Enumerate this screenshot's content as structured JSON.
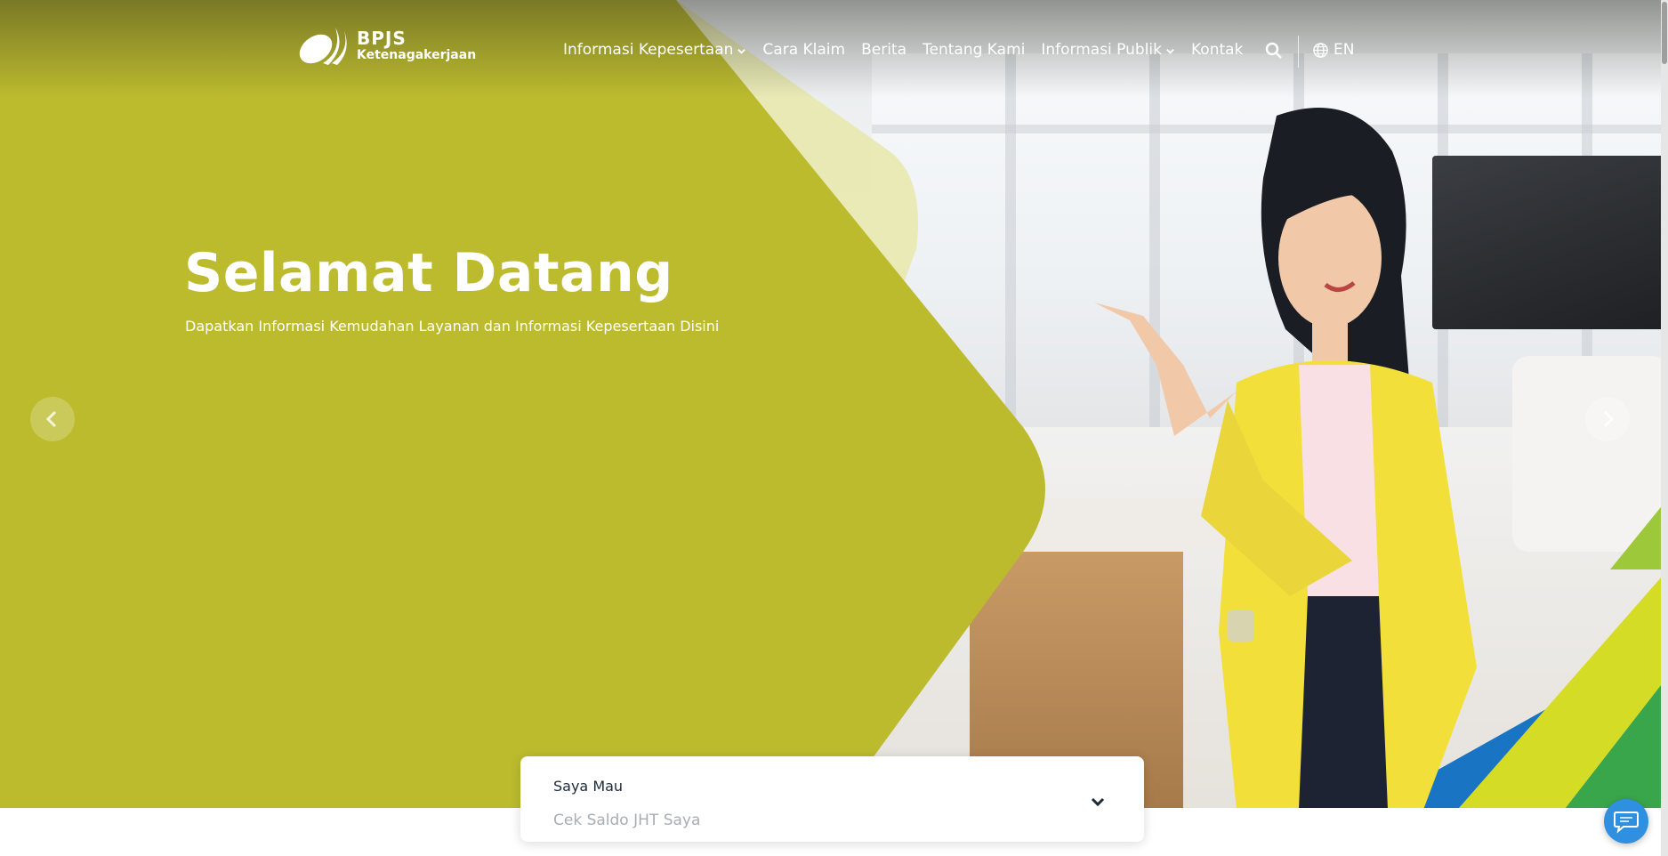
{
  "logo": {
    "title": "BPJS",
    "subtitle": "Ketenagakerjaan"
  },
  "nav": {
    "items": [
      {
        "label": "Informasi Kepesertaan",
        "has_dropdown": true
      },
      {
        "label": "Cara Klaim",
        "has_dropdown": false
      },
      {
        "label": "Berita",
        "has_dropdown": false
      },
      {
        "label": "Tentang Kami",
        "has_dropdown": false
      },
      {
        "label": "Informasi Publik",
        "has_dropdown": true
      },
      {
        "label": "Kontak",
        "has_dropdown": false
      }
    ],
    "search_icon": "search-icon",
    "language": {
      "icon": "globe-icon",
      "label": "EN"
    }
  },
  "hero": {
    "title": "Selamat Datang",
    "subtitle": "Dapatkan Informasi Kemudahan Layanan dan Informasi Kepesertaan Disini",
    "prev_icon": "chevron-left-icon",
    "next_icon": "chevron-right-icon"
  },
  "selector": {
    "label": "Saya Mau",
    "value": "Cek Saldo JHT Saya",
    "icon": "chevron-down-icon"
  },
  "chat": {
    "icon": "chat-bubble-icon"
  },
  "colors": {
    "olive": "#bcbb2e",
    "olive_light": "#dcdc8c",
    "green": "#3aa64c",
    "lime": "#d4dc26",
    "blue": "#1a74c4",
    "chat_blue": "#2f8fe0",
    "jacket_yellow": "#f2df3a"
  }
}
